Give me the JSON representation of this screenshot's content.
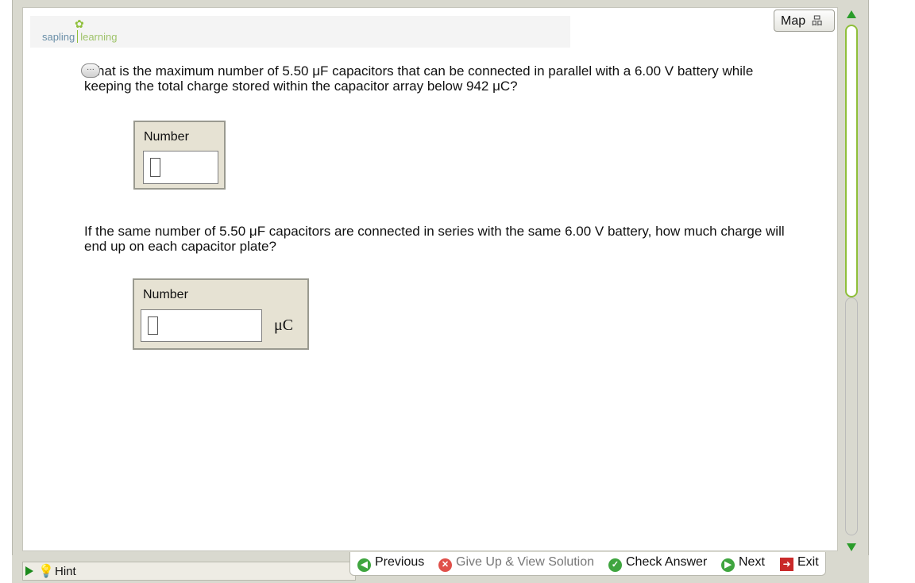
{
  "header": {
    "logo_left": "sapling",
    "logo_right": "learning",
    "map_label": "Map"
  },
  "questions": [
    {
      "text": "What is the maximum number of 5.50 μF capacitors that can be connected in parallel with a 6.00 V battery while keeping the total charge stored within the capacitor array below 942 μC?",
      "answer_label": "Number",
      "answer_value": "",
      "unit": ""
    },
    {
      "text": "If the same number of 5.50 μF capacitors are connected in series with the same 6.00 V battery, how much charge will end up on each capacitor plate?",
      "answer_label": "Number",
      "answer_value": "",
      "unit": "μC"
    }
  ],
  "footer": {
    "hint_label": "Hint",
    "previous_label": "Previous",
    "give_up_label": "Give Up & View Solution",
    "check_label": "Check Answer",
    "next_label": "Next",
    "exit_label": "Exit"
  },
  "colors": {
    "accent_green": "#3fa53f",
    "scroll_green": "#8fbf3a",
    "frame": "#d9d9cf",
    "answer_box": "#e6e2d3"
  }
}
